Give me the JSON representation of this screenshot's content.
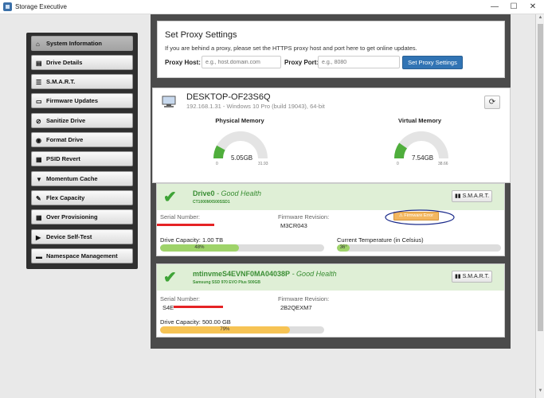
{
  "window": {
    "title": "Storage Executive",
    "min_label": "—",
    "max_label": "☐",
    "close_label": "✕"
  },
  "sidebar": {
    "items": [
      {
        "label": "System Information",
        "icon": "home-icon",
        "glyph": "⌂"
      },
      {
        "label": "Drive Details",
        "icon": "file-icon",
        "glyph": "▤"
      },
      {
        "label": "S.M.A.R.T.",
        "icon": "list-icon",
        "glyph": "☰"
      },
      {
        "label": "Firmware Updates",
        "icon": "flash-icon",
        "glyph": "▭"
      },
      {
        "label": "Sanitize Drive",
        "icon": "ban-icon",
        "glyph": "⊘"
      },
      {
        "label": "Format Drive",
        "icon": "record-icon",
        "glyph": "◉"
      },
      {
        "label": "PSID Revert",
        "icon": "bars-icon",
        "glyph": "▦"
      },
      {
        "label": "Momentum Cache",
        "icon": "filter-icon",
        "glyph": "▼"
      },
      {
        "label": "Flex Capacity",
        "icon": "edit-icon",
        "glyph": "✎"
      },
      {
        "label": "Over Provisioning",
        "icon": "grid-icon",
        "glyph": "▦"
      },
      {
        "label": "Device Self-Test",
        "icon": "forward-icon",
        "glyph": "▶"
      },
      {
        "label": "Namespace Management",
        "icon": "storage-icon",
        "glyph": "▬"
      }
    ]
  },
  "proxy": {
    "title": "Set Proxy Settings",
    "description": "If you are behind a proxy, please set the HTTPS proxy host and port here to get online updates.",
    "host_label": "Proxy Host:",
    "host_placeholder": "e.g., host.domain.com",
    "port_label": "Proxy Port:",
    "port_placeholder": "e.g., 8080",
    "button_label": "Set Proxy Settings"
  },
  "system": {
    "name": "DESKTOP-OF23S6Q",
    "subtitle": "192.168.1.31 - Windows 10 Pro (build 19043), 64-bit",
    "refresh_glyph": "⟳",
    "physical": {
      "title": "Physical Memory",
      "value": "5.05GB",
      "min": "0",
      "max": "31.93",
      "fraction": 0.158
    },
    "virtual": {
      "title": "Virtual Memory",
      "value": "7.54GB",
      "min": "0",
      "max": "38.66",
      "fraction": 0.195
    }
  },
  "drives": [
    {
      "check": "✔",
      "name": "Drive0",
      "health": " - Good Health",
      "model": "CT1000MX500SSD1",
      "smart_label": "S.M.A.R.T.",
      "serial_label": "Serial Number:",
      "serial_value": "",
      "fw_label": "Firmware Revision:",
      "fw_value": "M3CR043",
      "fw_button": "Firmware Error",
      "capacity_label": "Drive Capacity:",
      "capacity_value": "1.00 TB",
      "capacity_percent": 48,
      "capacity_text": "48%",
      "temp_label": "Current Temperature (in Celsius)",
      "temp_percent": 8,
      "temp_text": "36°"
    },
    {
      "check": "✔",
      "name": "mtinvmeS4EVNF0MA04038P",
      "health": " - Good Health",
      "model": "Samsung SSD 970 EVO Plus 500GB",
      "smart_label": "S.M.A.R.T.",
      "serial_label": "Serial Number:",
      "serial_value": "S4E",
      "fw_label": "Firmware Revision:",
      "fw_value": "2B2QEXM7",
      "capacity_label": "Drive Capacity:",
      "capacity_value": "500.00 GB",
      "capacity_percent": 79,
      "capacity_text": "79%"
    }
  ],
  "colors": {
    "healthy": "#3a8e34",
    "gauge_fill": "#4fae3c",
    "annotation": "#1a2a8a",
    "redaction": "#e52325"
  }
}
